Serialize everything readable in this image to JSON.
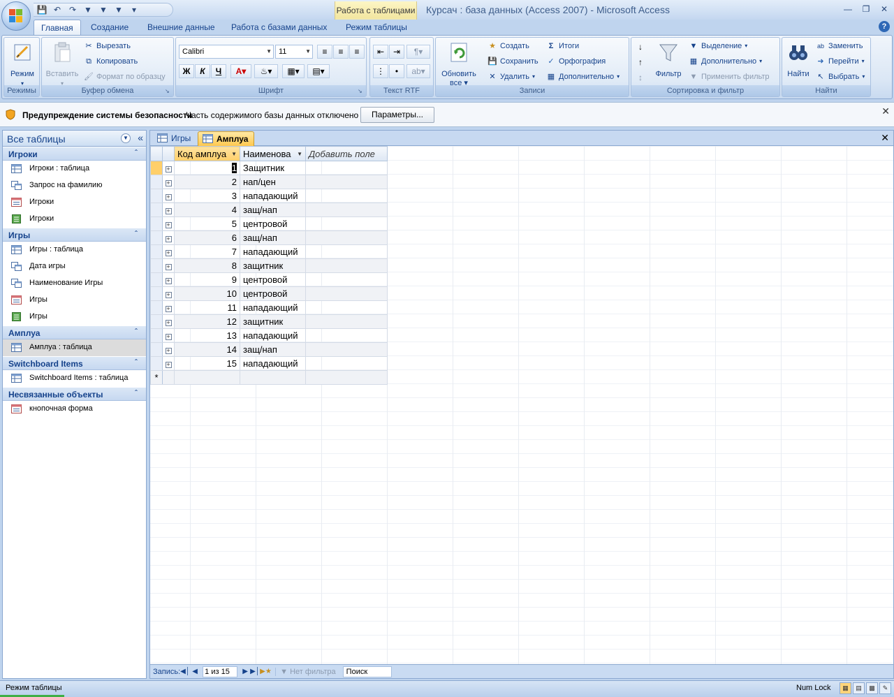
{
  "window": {
    "title": "Курсач : база данных (Access 2007)  -  Microsoft Access",
    "context_tab": "Работа с таблицами"
  },
  "ribbon_tabs": [
    {
      "label": "Главная",
      "active": true
    },
    {
      "label": "Создание"
    },
    {
      "label": "Внешние данные"
    },
    {
      "label": "Работа с базами данных"
    },
    {
      "label": "Режим таблицы"
    }
  ],
  "ribbon": {
    "views": {
      "label": "Режимы",
      "button": "Режим"
    },
    "clipboard": {
      "label": "Буфер обмена",
      "paste": "Вставить",
      "cut": "Вырезать",
      "copy": "Копировать",
      "format_painter": "Формат по образцу"
    },
    "font": {
      "label": "Шрифт",
      "family": "Calibri",
      "size": "11",
      "bold": "Ж",
      "italic": "К",
      "underline": "Ч"
    },
    "rtf": {
      "label": "Текст RTF"
    },
    "records": {
      "label": "Записи",
      "refresh": "Обновить",
      "refresh_all": "все",
      "new": "Создать",
      "save": "Сохранить",
      "delete": "Удалить",
      "totals": "Итоги",
      "spelling": "Орфография",
      "more": "Дополнительно"
    },
    "sort_filter": {
      "label": "Сортировка и фильтр",
      "filter": "Фильтр",
      "selection": "Выделение",
      "advanced": "Дополнительно",
      "toggle": "Применить фильтр"
    },
    "find": {
      "label": "Найти",
      "find": "Найти",
      "replace": "Заменить",
      "goto": "Перейти",
      "select": "Выбрать"
    }
  },
  "security": {
    "title": "Предупреждение системы безопасности",
    "message": "Часть содержимого базы данных отключено",
    "button": "Параметры..."
  },
  "nav": {
    "header": "Все таблицы",
    "groups": [
      {
        "title": "Игроки",
        "items": [
          {
            "label": "Игроки : таблица",
            "icon": "table-icon"
          },
          {
            "label": "Запрос на фамилию",
            "icon": "query-icon"
          },
          {
            "label": "Игроки",
            "icon": "form-icon"
          },
          {
            "label": "Игроки",
            "icon": "report-icon"
          }
        ]
      },
      {
        "title": "Игры",
        "items": [
          {
            "label": "Игры : таблица",
            "icon": "table-icon"
          },
          {
            "label": "Дата игры",
            "icon": "query-icon"
          },
          {
            "label": "Наименование Игры",
            "icon": "query-icon"
          },
          {
            "label": "Игры",
            "icon": "form-icon"
          },
          {
            "label": "Игры",
            "icon": "report-icon"
          }
        ]
      },
      {
        "title": "Амплуа",
        "items": [
          {
            "label": "Амплуа : таблица",
            "icon": "table-icon",
            "selected": true
          }
        ]
      },
      {
        "title": "Switchboard Items",
        "items": [
          {
            "label": "Switchboard Items : таблица",
            "icon": "table-icon"
          }
        ]
      },
      {
        "title": "Несвязанные объекты",
        "items": [
          {
            "label": "кнопочная форма",
            "icon": "form-icon"
          }
        ]
      }
    ]
  },
  "doc_tabs": [
    {
      "label": "Игры"
    },
    {
      "label": "Амплуа",
      "active": true
    }
  ],
  "table": {
    "columns": [
      "Код амплуа",
      "Наименова",
      "Добавить поле"
    ],
    "rows": [
      {
        "id": "1",
        "name": "Защитник"
      },
      {
        "id": "2",
        "name": "нап/цен"
      },
      {
        "id": "3",
        "name": "нападающий"
      },
      {
        "id": "4",
        "name": "защ/нап"
      },
      {
        "id": "5",
        "name": "центровой"
      },
      {
        "id": "6",
        "name": "защ/нап"
      },
      {
        "id": "7",
        "name": "нападающий"
      },
      {
        "id": "8",
        "name": "защитник"
      },
      {
        "id": "9",
        "name": "центровой"
      },
      {
        "id": "10",
        "name": "центровой"
      },
      {
        "id": "11",
        "name": "нападающий"
      },
      {
        "id": "12",
        "name": "защитник"
      },
      {
        "id": "13",
        "name": "нападающий"
      },
      {
        "id": "14",
        "name": "защ/нап"
      },
      {
        "id": "15",
        "name": "нападающий"
      }
    ],
    "new_row_marker": "*"
  },
  "record_nav": {
    "label": "Запись:",
    "position": "1 из 15",
    "filter": "Нет фильтра",
    "search": "Поиск"
  },
  "status": {
    "mode": "Режим таблицы",
    "numlock": "Num Lock"
  }
}
